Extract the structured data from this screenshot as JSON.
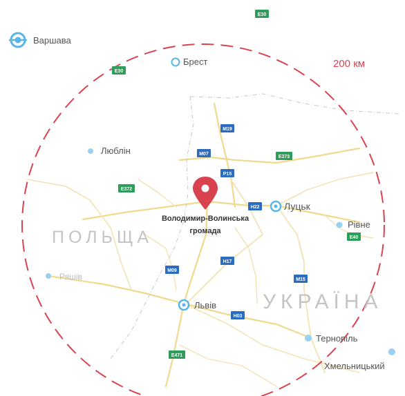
{
  "radius_label": "200 км",
  "focus": {
    "name_line1": "Володимир-Волинська",
    "name_line2": "громада",
    "marker_icon": "location-pin-icon",
    "color": "#d9424f"
  },
  "countries": [
    {
      "key": "poland",
      "label": "ПОЛЬЩА"
    },
    {
      "key": "ukraine",
      "label": "УКРАЇНА"
    }
  ],
  "cities": [
    {
      "key": "warsaw",
      "label": "Варшава",
      "capital": true
    },
    {
      "key": "brest",
      "label": "Брест"
    },
    {
      "key": "lublin",
      "label": "Люблін"
    },
    {
      "key": "lutsk",
      "label": "Луцьк"
    },
    {
      "key": "rivne",
      "label": "Рівне"
    },
    {
      "key": "rzeszow",
      "label": "Ряшів"
    },
    {
      "key": "lviv",
      "label": "Львів"
    },
    {
      "key": "ternopil",
      "label": "Тернопіль"
    },
    {
      "key": "khmelnytskyi",
      "label": "Хмельницький"
    }
  ],
  "road_shields": [
    {
      "key": "e30-top",
      "label": "E30",
      "kind": "euro"
    },
    {
      "key": "e30-mid",
      "label": "E30",
      "kind": "euro"
    },
    {
      "key": "m19",
      "label": "M19",
      "kind": "national"
    },
    {
      "key": "m07",
      "label": "M07",
      "kind": "national"
    },
    {
      "key": "e373",
      "label": "E373",
      "kind": "euro"
    },
    {
      "key": "p15",
      "label": "P15",
      "kind": "national"
    },
    {
      "key": "e372",
      "label": "E372",
      "kind": "euro"
    },
    {
      "key": "h22",
      "label": "H22",
      "kind": "national"
    },
    {
      "key": "e40",
      "label": "E40",
      "kind": "euro"
    },
    {
      "key": "m09",
      "label": "M09",
      "kind": "national"
    },
    {
      "key": "h17",
      "label": "H17",
      "kind": "national"
    },
    {
      "key": "m15",
      "label": "M15",
      "kind": "national"
    },
    {
      "key": "h03",
      "label": "H03",
      "kind": "national"
    },
    {
      "key": "e471",
      "label": "E471",
      "kind": "euro"
    }
  ],
  "colors": {
    "circle": "#d9424f",
    "city_dot": "#58b5e8",
    "city_text": "#555555",
    "country_text": "#c4c4c4",
    "euro_shield": "#2e9d5a",
    "national_shield": "#2b6cc0",
    "road": "#f1d98c",
    "road_minor": "#f3e3b4"
  }
}
